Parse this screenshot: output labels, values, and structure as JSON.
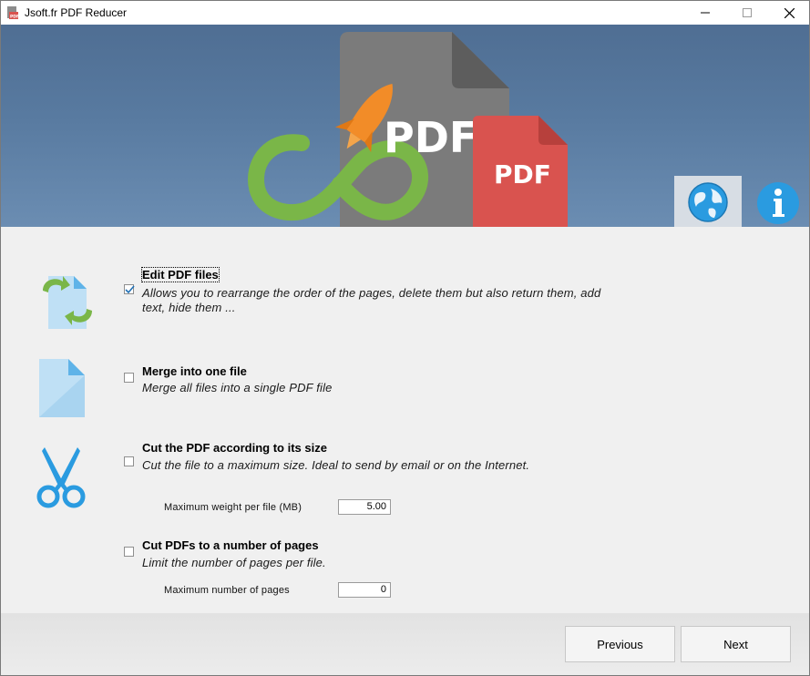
{
  "window": {
    "title": "Jsoft.fr PDF Reducer"
  },
  "banner": {
    "doc_back_label": "PDF",
    "doc_front_label": "PDF"
  },
  "options": [
    {
      "title": "Edit PDF files",
      "description": "Allows you to rearrange the order of the pages, delete them but also return them, add text, hide them ...",
      "checked": true
    },
    {
      "title": "Merge into one file",
      "description": "Merge all files into a single PDF file",
      "checked": false
    },
    {
      "title": "Cut the PDF according to its size",
      "description": "Cut the file to a maximum size. Ideal to send by email or on the Internet.",
      "checked": false,
      "field_label": "Maximum weight per file (MB)",
      "field_value": "5.00"
    },
    {
      "title": "Cut PDFs to a number of pages",
      "description": "Limit the number of pages per file.",
      "checked": false,
      "field_label": "Maximum number of pages",
      "field_value": "0"
    }
  ],
  "footer": {
    "previous_label": "Previous",
    "next_label": "Next"
  },
  "icons": {
    "app": "pdf-app-icon",
    "option1": "edit-files-icon",
    "option2": "document-icon",
    "option3": "scissors-icon",
    "language": "globe-icon",
    "about": "info-icon"
  },
  "colors": {
    "banner_bg": "#587aa0",
    "accent_blue": "#2a9be0",
    "accent_green": "#7ab648",
    "accent_orange": "#f28c28",
    "pdf_red": "#d9534f",
    "pdf_gray": "#7b7b7b"
  }
}
